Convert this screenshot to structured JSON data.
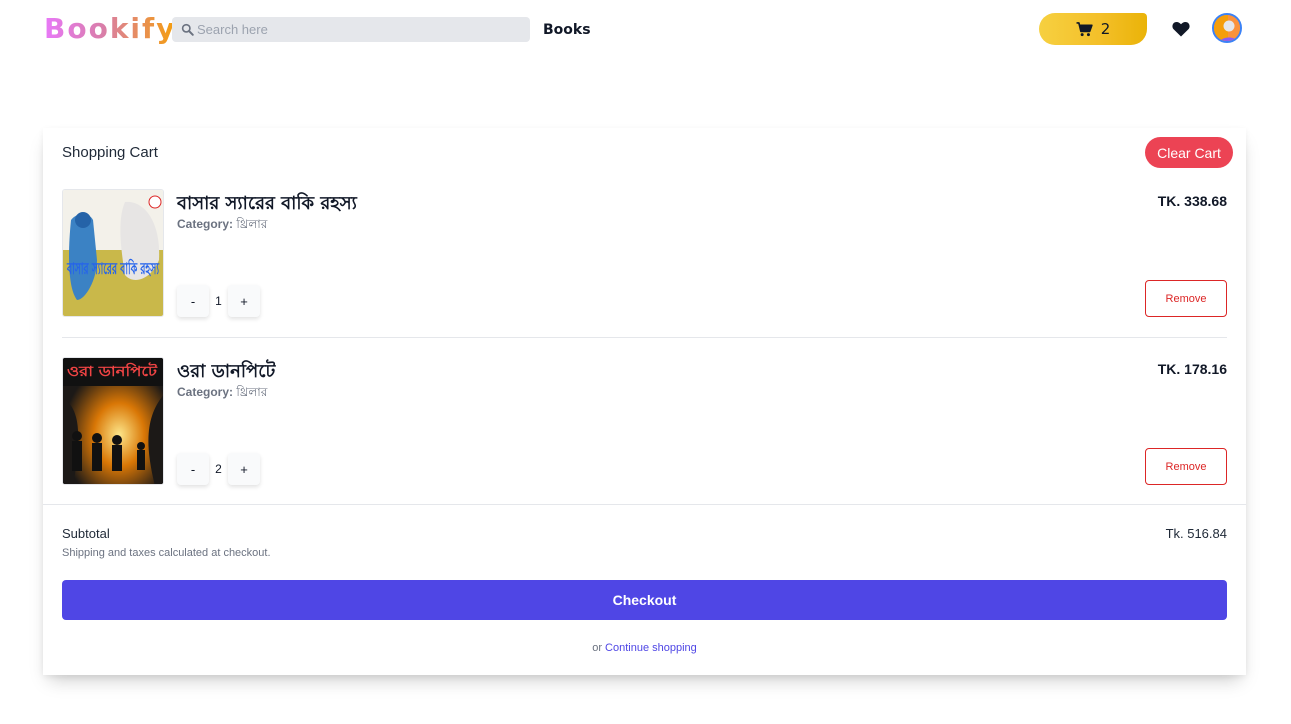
{
  "header": {
    "logo": "Bookify",
    "search_placeholder": "Search here",
    "nav_books": "Books",
    "cart_count": "2",
    "icons": {
      "search": "search-icon",
      "cart": "cart-icon",
      "wishlist": "heart-icon",
      "avatar": "avatar"
    }
  },
  "cart": {
    "title": "Shopping Cart",
    "clear_label": "Clear Cart",
    "items": [
      {
        "title": "বাসার স্যারের বাকি রহস্য",
        "category_label": "Category:",
        "category": "থ্রিলার",
        "price": "TK. 338.68",
        "quantity": "1",
        "minus": "-",
        "plus": "+",
        "remove_label": "Remove",
        "cover_text": "বাসার স্যারের বাকি রহস্য"
      },
      {
        "title": "ওরা ডানপিটে",
        "category_label": "Category:",
        "category": "থ্রিলার",
        "price": "TK. 178.16",
        "quantity": "2",
        "minus": "-",
        "plus": "+",
        "remove_label": "Remove",
        "cover_text": "ওরা ডানপিটে"
      }
    ],
    "subtotal_label": "Subtotal",
    "subtotal_value": "Tk. 516.84",
    "shipping_note": "Shipping and taxes calculated at checkout.",
    "checkout_label": "Checkout",
    "continue_prefix": "or",
    "continue_link": "Continue shopping"
  },
  "colors": {
    "brand_gradient_start": "#e879f9",
    "brand_gradient_end": "#f59e0b",
    "cart_button": "#f4c02a",
    "clear_button": "#ec4354",
    "checkout": "#4f46e5",
    "remove": "#dc2626"
  }
}
